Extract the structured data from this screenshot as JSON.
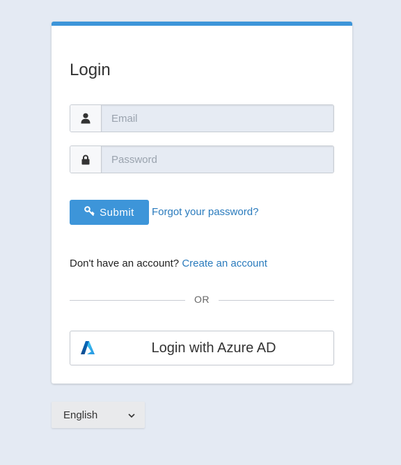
{
  "login": {
    "title": "Login",
    "email_placeholder": "Email",
    "password_placeholder": "Password",
    "submit_label": "Submit",
    "forgot_password": "Forgot your password?",
    "no_account_text": "Don't have an account?",
    "create_account": "Create an account",
    "divider_text": "OR",
    "azure_label": "Login with Azure AD"
  },
  "language": {
    "selected": "English"
  },
  "icons": {
    "email_field": "user-icon",
    "password_field": "lock-icon",
    "submit": "key-icon",
    "azure": "azure-logo-icon",
    "language": "chevron-down-icon"
  },
  "colors": {
    "accent": "#3d95d9",
    "link": "#2a7bbd",
    "background": "#e4eaf3"
  }
}
